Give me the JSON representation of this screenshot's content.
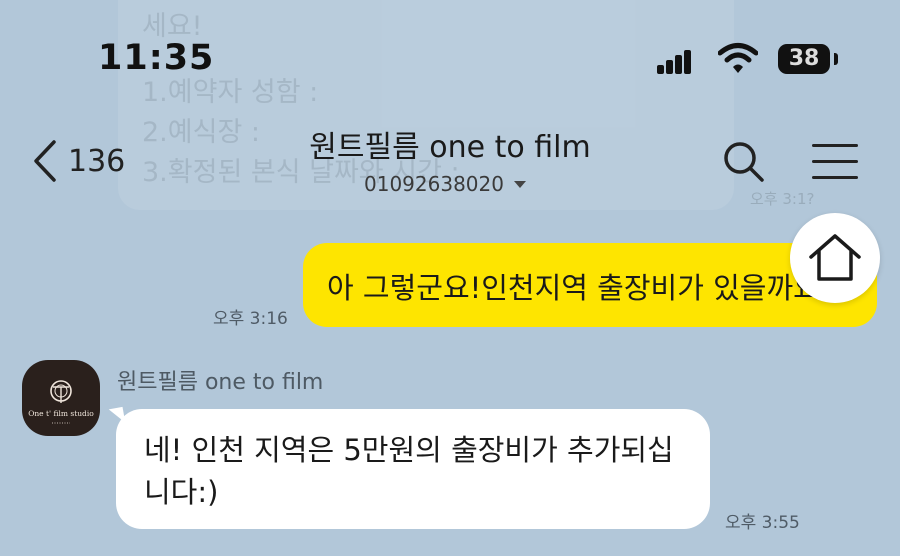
{
  "status_bar": {
    "time": "11:35",
    "battery_percent": "38"
  },
  "background_preview": {
    "lines": [
      "세요!",
      "1.예약자 성함 :",
      "2.예식장 :",
      "3.확정된 본식 날짜와 시간 :"
    ],
    "time": "오후 3:1?"
  },
  "header": {
    "back_count": "136",
    "title": "원트필름 one to film",
    "phone": "01092638020"
  },
  "messages": [
    {
      "direction": "outgoing",
      "text": "아 그렇군요!인천지역 출장비가 있을까요?",
      "time": "오후 3:16"
    },
    {
      "direction": "incoming",
      "sender": "원트필름 one to film",
      "avatar_brand": "One t' film studio",
      "text": "네! 인천 지역은 5만원의 출장비가 추가되십니다:)",
      "time": "오후 3:55"
    }
  ],
  "colors": {
    "background": "#b2c7d9",
    "outgoing_bubble": "#fee500",
    "incoming_bubble": "#ffffff"
  },
  "icons": {
    "back": "chevron-left-icon",
    "search": "search-icon",
    "menu": "hamburger-menu-icon",
    "home": "home-icon",
    "dropdown": "caret-down-icon"
  }
}
